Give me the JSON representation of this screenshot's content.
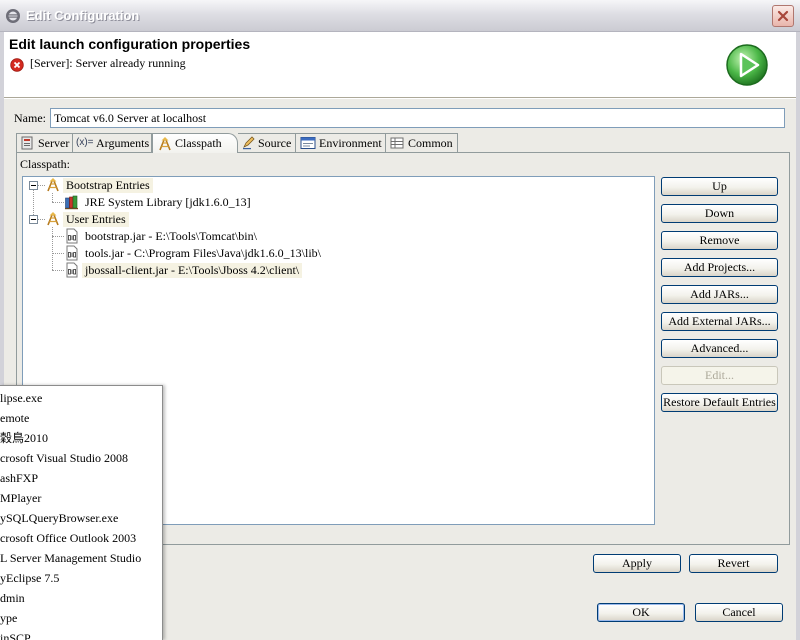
{
  "window": {
    "title": "Edit Configuration",
    "icon": "eclipse-icon",
    "close_icon": "close-icon"
  },
  "header": {
    "title": "Edit launch configuration properties",
    "message": "[Server]: Server already running",
    "message_icon": "error-icon",
    "banner_icon": "run-icon"
  },
  "name_field": {
    "label": "Name:",
    "value": "Tomcat v6.0 Server at localhost"
  },
  "tabs": [
    {
      "label": "Server",
      "icon": "server-icon",
      "selected": false
    },
    {
      "label": "Arguments",
      "icon": "arguments-icon",
      "icon_glyph": "(x)=",
      "selected": false
    },
    {
      "label": "Classpath",
      "icon": "classpath-icon",
      "selected": true
    },
    {
      "label": "Source",
      "icon": "source-icon",
      "selected": false
    },
    {
      "label": "Environment",
      "icon": "environment-icon",
      "selected": false
    },
    {
      "label": "Common",
      "icon": "common-icon",
      "selected": false
    }
  ],
  "classpath": {
    "label": "Classpath:",
    "tree": [
      {
        "label": "Bootstrap Entries",
        "icon": "classpath-entries-icon",
        "level": 0,
        "expanded": true
      },
      {
        "label": "JRE System Library [jdk1.6.0_13]",
        "icon": "library-icon",
        "level": 1
      },
      {
        "label": "User Entries",
        "icon": "classpath-entries-icon",
        "level": 0,
        "expanded": true
      },
      {
        "label": "bootstrap.jar - E:\\Tools\\Tomcat\\bin\\",
        "icon": "jar-icon",
        "level": 1
      },
      {
        "label": "tools.jar - C:\\Program Files\\Java\\jdk1.6.0_13\\lib\\",
        "icon": "jar-icon",
        "level": 1
      },
      {
        "label": "jbossall-client.jar - E:\\Tools\\Jboss 4.2\\client\\",
        "icon": "jar-icon",
        "level": 1,
        "selected": true
      }
    ],
    "buttons": [
      {
        "label": "Up",
        "enabled": true
      },
      {
        "label": "Down",
        "enabled": true
      },
      {
        "label": "Remove",
        "enabled": true
      },
      {
        "label": "Add Projects...",
        "enabled": true
      },
      {
        "label": "Add JARs...",
        "enabled": true
      },
      {
        "label": "Add External JARs...",
        "enabled": true
      },
      {
        "label": "Advanced...",
        "enabled": true
      },
      {
        "label": "Edit...",
        "enabled": false
      },
      {
        "label": "Restore Default Entries",
        "enabled": true
      }
    ]
  },
  "footer": {
    "apply": "Apply",
    "revert": "Revert",
    "ok": "OK",
    "cancel": "Cancel"
  },
  "popup_menu": {
    "items": [
      "lipse.exe",
      "emote",
      "穀鳥2010",
      "crosoft Visual Studio 2008",
      "ashFXP",
      "MPlayer",
      "ySQLQueryBrowser.exe",
      "crosoft Office Outlook 2003",
      "L Server Management Studio",
      "yEclipse 7.5",
      "dmin",
      "ype",
      "inSCP"
    ]
  },
  "colors": {
    "button_border": "#003C74",
    "error": "#D42A1F",
    "run_green": "#4CB848",
    "field_border": "#7F9DB9",
    "dialog_bg": "#ECEBE6"
  }
}
